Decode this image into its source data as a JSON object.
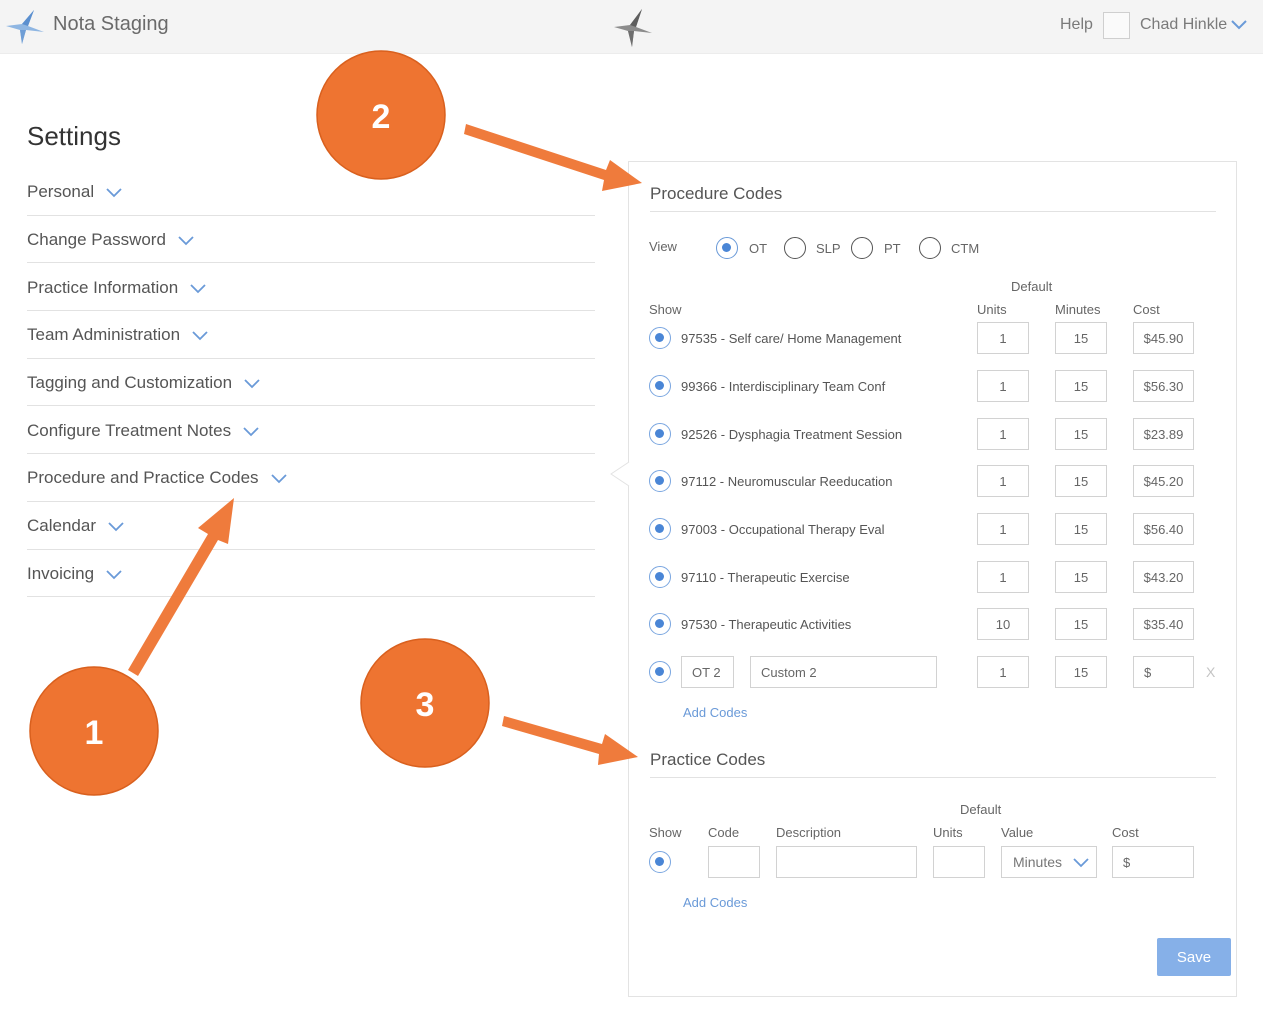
{
  "header": {
    "app_title": "Nota Staging",
    "help": "Help",
    "user_name": "Chad Hinkle",
    "logo_icon": "bird-logo-icon",
    "avatar_icon": "avatar-placeholder-icon"
  },
  "sidebar": {
    "title": "Settings",
    "items": [
      {
        "label": "Personal"
      },
      {
        "label": "Change Password"
      },
      {
        "label": "Practice Information"
      },
      {
        "label": "Team Administration"
      },
      {
        "label": "Tagging and Customization"
      },
      {
        "label": "Configure Treatment Notes"
      },
      {
        "label": "Procedure and Practice Codes"
      },
      {
        "label": "Calendar"
      },
      {
        "label": "Invoicing"
      }
    ]
  },
  "procedure": {
    "title": "Procedure Codes",
    "view_label": "View",
    "view_options": [
      {
        "label": "OT",
        "selected": true
      },
      {
        "label": "SLP",
        "selected": false
      },
      {
        "label": "PT",
        "selected": false
      },
      {
        "label": "CTM",
        "selected": false
      }
    ],
    "default_label": "Default",
    "col_show": "Show",
    "col_units": "Units",
    "col_minutes": "Minutes",
    "col_cost": "Cost",
    "rows": [
      {
        "label": "97535 - Self care/ Home Management",
        "units": "1",
        "minutes": "15",
        "cost": "$45.90"
      },
      {
        "label": "99366 - Interdisciplinary Team Conf",
        "units": "1",
        "minutes": "15",
        "cost": "$56.30"
      },
      {
        "label": "92526 - Dysphagia Treatment Session",
        "units": "1",
        "minutes": "15",
        "cost": "$23.89"
      },
      {
        "label": "97112 - Neuromuscular Reeducation",
        "units": "1",
        "minutes": "15",
        "cost": "$45.20"
      },
      {
        "label": "97003 - Occupational Therapy Eval",
        "units": "1",
        "minutes": "15",
        "cost": "$56.40"
      },
      {
        "label": "97110 - Therapeutic Exercise",
        "units": "1",
        "minutes": "15",
        "cost": "$43.20"
      },
      {
        "label": "97530 - Therapeutic Activities",
        "units": "10",
        "minutes": "15",
        "cost": "$35.40"
      }
    ],
    "custom_row": {
      "code": "OT 2",
      "description": "Custom 2",
      "units": "1",
      "minutes": "15",
      "cost": "$",
      "remove": "X"
    },
    "add_codes": "Add Codes"
  },
  "practice": {
    "title": "Practice Codes",
    "default_label": "Default",
    "col_show": "Show",
    "col_code": "Code",
    "col_description": "Description",
    "col_units": "Units",
    "col_value": "Value",
    "col_cost": "Cost",
    "row": {
      "code": "",
      "description": "",
      "units": "",
      "value": "Minutes",
      "cost": "$"
    },
    "add_codes": "Add Codes"
  },
  "save_label": "Save",
  "annotations": {
    "badges": [
      "1",
      "2",
      "3"
    ],
    "color": "#ee7431"
  },
  "colors": {
    "accent": "#4a86d6",
    "save_button": "#86b0e8",
    "annotation": "#ee7431"
  }
}
